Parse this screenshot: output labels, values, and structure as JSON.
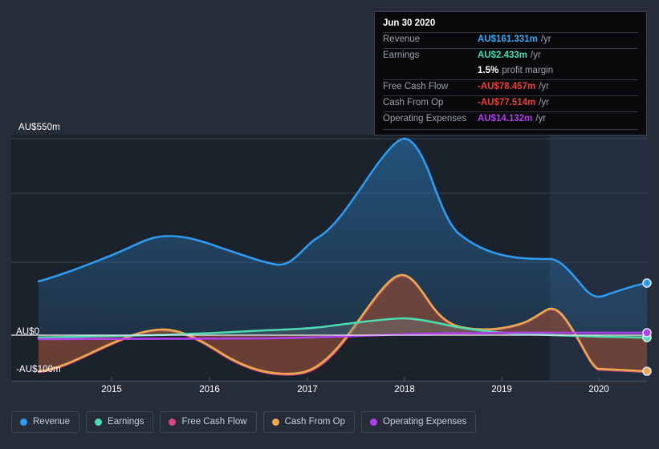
{
  "background_color": "#262d38",
  "tooltip": {
    "date": "Jun 30 2020",
    "rows": [
      {
        "label": "Revenue",
        "value": "AU$161.331m",
        "unit": "/yr",
        "color": "#3ea6f5"
      },
      {
        "label": "Earnings",
        "value": "AU$2.433m",
        "unit": "/yr",
        "color": "#4ddbb0"
      },
      {
        "label": "",
        "value": "1.5%",
        "unit": "profit margin",
        "color": "#ffffff"
      },
      {
        "label": "Free Cash Flow",
        "value": "-AU$78.457m",
        "unit": "/yr",
        "color": "#e8413c"
      },
      {
        "label": "Cash From Op",
        "value": "-AU$77.514m",
        "unit": "/yr",
        "color": "#e8413c"
      },
      {
        "label": "Operating Expenses",
        "value": "AU$14.132m",
        "unit": "/yr",
        "color": "#b03ff0"
      }
    ]
  },
  "legend": {
    "items": [
      {
        "label": "Revenue",
        "color": "#2f9bf0"
      },
      {
        "label": "Earnings",
        "color": "#4ddbb0"
      },
      {
        "label": "Free Cash Flow",
        "color": "#d6487e"
      },
      {
        "label": "Cash From Op",
        "color": "#eaa94e"
      },
      {
        "label": "Operating Expenses",
        "color": "#b03ff0"
      }
    ]
  },
  "chart_data": {
    "type": "area",
    "title": "",
    "xlabel": "",
    "ylabel": "AU$",
    "currency": "AU$",
    "units": "millions",
    "ylim": [
      -150,
      550
    ],
    "yticks": [
      550,
      0,
      -100
    ],
    "ytick_labels": [
      "AU$550m",
      "AU$0",
      "-AU$100m"
    ],
    "gridlines": [
      550,
      430,
      280,
      120,
      0,
      -100
    ],
    "x": [
      "2014.4",
      "2015",
      "2015.4",
      "2016",
      "2016.5",
      "2017",
      "2017.5",
      "2018",
      "2018.3",
      "2019",
      "2019.6",
      "2020",
      "2020.5"
    ],
    "xtick_labels": [
      "2015",
      "2016",
      "2017",
      "2018",
      "2019",
      "2020"
    ],
    "legend_position": "bottom",
    "grid": true,
    "forecast_region_start": "2019.55",
    "series": [
      {
        "name": "Revenue",
        "color": "#2f9bf0",
        "fill": true,
        "values": [
          128,
          178,
          232,
          225,
          212,
          207,
          290,
          550,
          400,
          340,
          330,
          175,
          161.331
        ]
      },
      {
        "name": "Earnings",
        "color": "#4ddbb0",
        "fill": true,
        "values": [
          -4,
          -3,
          0,
          2,
          5,
          8,
          20,
          38,
          30,
          14,
          8,
          4,
          2.433
        ]
      },
      {
        "name": "Free Cash Flow",
        "color": "#d6487e",
        "fill": true,
        "values": [
          -102,
          -70,
          -20,
          5,
          -30,
          -68,
          20,
          130,
          45,
          40,
          75,
          -80,
          -78.457
        ]
      },
      {
        "name": "Cash From Op",
        "color": "#eaa94e",
        "fill": true,
        "values": [
          -100,
          -68,
          -18,
          8,
          -28,
          -66,
          22,
          132,
          48,
          42,
          78,
          -78,
          -77.514
        ]
      },
      {
        "name": "Operating Expenses",
        "color": "#b03ff0",
        "fill": false,
        "values": [
          0,
          0,
          0,
          0,
          4,
          8,
          10,
          11,
          11,
          12,
          13,
          14,
          14.132
        ]
      }
    ]
  }
}
